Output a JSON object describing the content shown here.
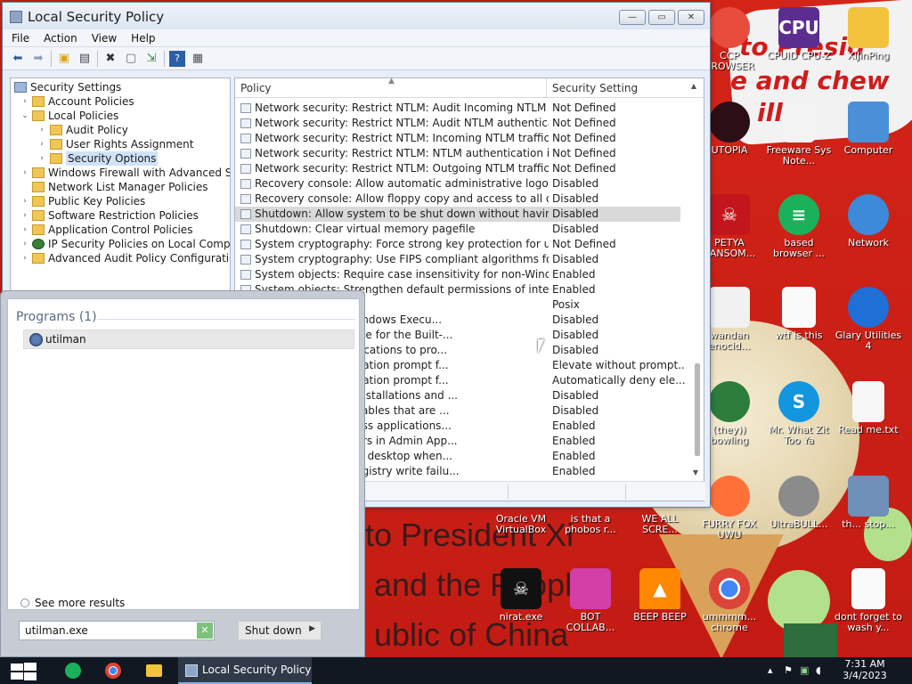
{
  "desktop": {
    "wallpaper_text": [
      "to Presid",
      "e and chew",
      "illin"
    ],
    "banner_lines": [
      "to President Xi",
      "and the People",
      "ublic of China"
    ],
    "icons": [
      {
        "label": "CCP BROWSER",
        "icon": "browser-icon",
        "color": "#e84c3d"
      },
      {
        "label": "CPUID CPU-Z",
        "icon": "cpuz-icon",
        "color": "#5c2d91"
      },
      {
        "label": "XiJinPing",
        "icon": "folder-user-icon",
        "color": "#f2c43d"
      },
      {
        "label": "UTOPIA",
        "icon": "utopia-icon",
        "color": "#2b0f14"
      },
      {
        "label": "Freeware Sys Note...",
        "icon": "document-icon",
        "color": "#f3f3f3"
      },
      {
        "label": "Computer",
        "icon": "computer-icon",
        "color": "#4a90d9"
      },
      {
        "label": "PETYA RANSOM...",
        "icon": "skull-icon",
        "color": "#c3161c"
      },
      {
        "label": "based browser ...",
        "icon": "chat-icon",
        "color": "#1ab15a"
      },
      {
        "label": "Network",
        "icon": "network-icon",
        "color": "#3c8ad8"
      },
      {
        "label": "wandan enocid...",
        "icon": "face-icon",
        "color": "#f1f1f1"
      },
      {
        "label": "wtf is this",
        "icon": "calendar-file-icon",
        "color": "#fafafa"
      },
      {
        "label": "Glary Utilities 4",
        "icon": "glary-icon",
        "color": "#1f6fd6"
      },
      {
        "label": "(they)) bowling",
        "icon": "santa-icon",
        "color": "#2c7d3c"
      },
      {
        "label": "Mr. What Zit Too Ya",
        "icon": "skype-icon",
        "color": "#1296e0"
      },
      {
        "label": "Read me.txt",
        "icon": "text-file-icon",
        "color": "#f6f6f6"
      },
      {
        "label": "Oracle VM VirtualBox",
        "icon": "virtualbox-icon",
        "color": "#1b5fa8"
      },
      {
        "label": "is that a phobos r...",
        "icon": "app-icon",
        "color": "#777777"
      },
      {
        "label": "WE ALL SCRE...",
        "icon": "app-icon",
        "color": "#777777"
      },
      {
        "label": "FURRY FOX UWU",
        "icon": "firefox-icon",
        "color": "#ff7139"
      },
      {
        "label": "UltraBULL...",
        "icon": "disc-icon",
        "color": "#8b8b8b"
      },
      {
        "label": "th... stop...",
        "icon": "computer-icon",
        "color": "#6d8fb8"
      },
      {
        "label": "nirat.exe",
        "icon": "skull-icon",
        "color": "#111111"
      },
      {
        "label": "BOT COLLAB...",
        "icon": "monitor-icon",
        "color": "#d43ea7"
      },
      {
        "label": "BEEP BEEP",
        "icon": "vlc-icon",
        "color": "#ff8800"
      },
      {
        "label": "ummmm... chrome",
        "icon": "chrome-icon",
        "color": "#db4437"
      },
      {
        "label": "dont forget to wash y...",
        "icon": "calendar-file-icon",
        "color": "#fafafa"
      }
    ]
  },
  "window": {
    "title": "Local Security Policy",
    "menu": [
      "File",
      "Action",
      "View",
      "Help"
    ],
    "controls": {
      "minimize": "—",
      "maximize": "▭",
      "close": "✕"
    },
    "toolbar_icons": [
      "back-icon",
      "forward-icon",
      "up-folder-icon",
      "show-tree-icon",
      "delete-icon",
      "properties-icon",
      "export-icon",
      "help-icon",
      "view-icon"
    ]
  },
  "tree": [
    {
      "label": "Security Settings",
      "level": 0,
      "arrow": "",
      "icon": "security-root-icon"
    },
    {
      "label": "Account Policies",
      "level": 1,
      "arrow": "›",
      "icon": "folder-lock-icon"
    },
    {
      "label": "Local Policies",
      "level": 1,
      "arrow": "⌄",
      "icon": "folder-lock-icon"
    },
    {
      "label": "Audit Policy",
      "level": 2,
      "arrow": "›",
      "icon": "folder-lock-icon"
    },
    {
      "label": "User Rights Assignment",
      "level": 2,
      "arrow": "›",
      "icon": "folder-lock-icon"
    },
    {
      "label": "Security Options",
      "level": 2,
      "arrow": "›",
      "icon": "folder-lock-icon",
      "selected": true
    },
    {
      "label": "Windows Firewall with Advanced Sec",
      "level": 1,
      "arrow": "›",
      "icon": "folder-icon"
    },
    {
      "label": "Network List Manager Policies",
      "level": 1,
      "arrow": "",
      "icon": "folder-icon"
    },
    {
      "label": "Public Key Policies",
      "level": 1,
      "arrow": "›",
      "icon": "folder-icon"
    },
    {
      "label": "Software Restriction Policies",
      "level": 1,
      "arrow": "›",
      "icon": "folder-icon"
    },
    {
      "label": "Application Control Policies",
      "level": 1,
      "arrow": "›",
      "icon": "folder-icon"
    },
    {
      "label": "IP Security Policies on Local Comput",
      "level": 1,
      "arrow": "›",
      "icon": "shield-globe-icon"
    },
    {
      "label": "Advanced Audit Policy Configuration",
      "level": 1,
      "arrow": "›",
      "icon": "folder-icon"
    }
  ],
  "list": {
    "col_policy": "Policy",
    "col_setting": "Security Setting",
    "rows": [
      {
        "policy": "Network security: Restrict NTLM: Audit Incoming NTLM T...",
        "setting": "Not Defined"
      },
      {
        "policy": "Network security: Restrict NTLM: Audit NTLM authenticati...",
        "setting": "Not Defined"
      },
      {
        "policy": "Network security: Restrict NTLM: Incoming NTLM traffic",
        "setting": "Not Defined"
      },
      {
        "policy": "Network security: Restrict NTLM: NTLM authentication in ...",
        "setting": "Not Defined"
      },
      {
        "policy": "Network security: Restrict NTLM: Outgoing NTLM traffic t...",
        "setting": "Not Defined"
      },
      {
        "policy": "Recovery console: Allow automatic administrative logon",
        "setting": "Disabled"
      },
      {
        "policy": "Recovery console: Allow floppy copy and access to all dri...",
        "setting": "Disabled"
      },
      {
        "policy": "Shutdown: Allow system to be shut down without having t...",
        "setting": "Disabled",
        "highlight": true
      },
      {
        "policy": "Shutdown: Clear virtual memory pagefile",
        "setting": "Disabled"
      },
      {
        "policy": "System cryptography: Force strong key protection for us...",
        "setting": "Not Defined"
      },
      {
        "policy": "System cryptography: Use FIPS compliant algorithms for ...",
        "setting": "Disabled"
      },
      {
        "policy": "System objects: Require case insensitivity for non-Windo...",
        "setting": "Enabled"
      },
      {
        "policy": "System objects: Strengthen default permissions of internal...",
        "setting": "Enabled"
      },
      {
        "policy": "al subsystems",
        "setting": "Posix"
      },
      {
        "policy": "rtificate Rules on Windows Execu...",
        "setting": "Disabled"
      },
      {
        "policy": "Admin Approval Mode for the Built-...",
        "setting": "Disabled"
      },
      {
        "policy": "Allow UIAccess applications to pro...",
        "setting": "Disabled"
      },
      {
        "policy": "Behavior of the elevation prompt f...",
        "setting": "Elevate without prompt..."
      },
      {
        "policy": "Behavior of the elevation prompt f...",
        "setting": "Automatically deny ele..."
      },
      {
        "policy": "Detect application installations and ...",
        "setting": "Disabled"
      },
      {
        "policy": "Only elevate executables that are ...",
        "setting": "Disabled"
      },
      {
        "policy": "Only elevate UIAccess applications...",
        "setting": "Enabled"
      },
      {
        "policy": "Run all administrators in Admin App...",
        "setting": "Enabled"
      },
      {
        "policy": "Switch to the secure desktop when...",
        "setting": "Enabled"
      },
      {
        "policy": "Virtualize file and registry write failu...",
        "setting": "Enabled"
      }
    ]
  },
  "startmenu": {
    "section_title": "Programs (1)",
    "result_label": "utilman",
    "see_more": "See more results",
    "search_value": "utilman.exe",
    "shutdown_label": "Shut down",
    "shutdown_arrow": "▶",
    "clear_icon": "✕"
  },
  "taskbar": {
    "active_window": "Local Security Policy",
    "time": "7:31 AM",
    "date": "3/4/2023"
  }
}
